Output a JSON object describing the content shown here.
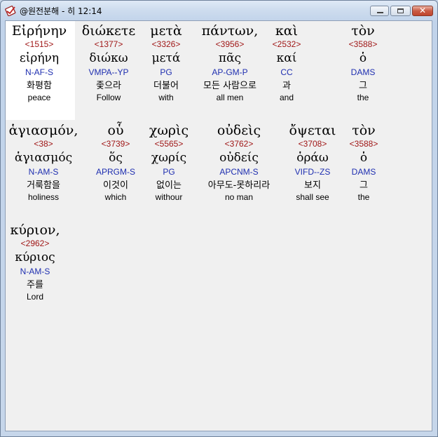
{
  "window": {
    "title": "@원전분해 - 히 12:14",
    "icon": "analysis-app-icon",
    "controls": {
      "minimize": "minimize-icon",
      "maximize": "maximize-icon",
      "close": "✕"
    }
  },
  "words": [
    {
      "greek": "Εἰρήνην",
      "strongs": "<1515>",
      "lemma": "εἰρήνη",
      "parsing": "N-AF-S",
      "korean": "화평함",
      "english": "peace",
      "selected": true
    },
    {
      "greek": "διώκετε",
      "strongs": "<1377>",
      "lemma": "διώκω",
      "parsing": "VMPA--YP",
      "korean": "좇으라",
      "english": "Follow"
    },
    {
      "greek": "μετὰ",
      "strongs": "<3326>",
      "lemma": "μετά",
      "parsing": "PG",
      "korean": "더불어",
      "english": "with"
    },
    {
      "greek": "πάντων,",
      "strongs": "<3956>",
      "lemma": "πᾶς",
      "parsing": "AP-GM-P",
      "korean": "모든 사람으로",
      "english": "all men"
    },
    {
      "greek": "καὶ",
      "strongs": "<2532>",
      "lemma": "καί",
      "parsing": "CC",
      "korean": "과",
      "english": "and"
    },
    {
      "greek": "τὸν",
      "strongs": "<3588>",
      "lemma": "ὁ",
      "parsing": "DAMS",
      "korean": "그",
      "english": "the"
    },
    {
      "greek": "ἁγιασμόν,",
      "strongs": "<38>",
      "lemma": "ἁγιασμός",
      "parsing": "N-AM-S",
      "korean": "거룩함을",
      "english": "holiness"
    },
    {
      "greek": "οὗ",
      "strongs": "<3739>",
      "lemma": "ὅς",
      "parsing": "APRGM-S",
      "korean": "이것이",
      "english": "which"
    },
    {
      "greek": "χωρὶς",
      "strongs": "<5565>",
      "lemma": "χωρίς",
      "parsing": "PG",
      "korean": "없이는",
      "english": "withour"
    },
    {
      "greek": "οὐδεὶς",
      "strongs": "<3762>",
      "lemma": "οὐδείς",
      "parsing": "APCNM-S",
      "korean": "아무도-못하리라",
      "english": "no man"
    },
    {
      "greek": "ὄψεται",
      "strongs": "<3708>",
      "lemma": "ὁράω",
      "parsing": "VIFD--ZS",
      "korean": "보지",
      "english": "shall see"
    },
    {
      "greek": "τὸν",
      "strongs": "<3588>",
      "lemma": "ὁ",
      "parsing": "DAMS",
      "korean": "그",
      "english": "the"
    },
    {
      "greek": "κύριον,",
      "strongs": "<2962>",
      "lemma": "κύριος",
      "parsing": "N-AM-S",
      "korean": "주를",
      "english": "Lord"
    }
  ]
}
